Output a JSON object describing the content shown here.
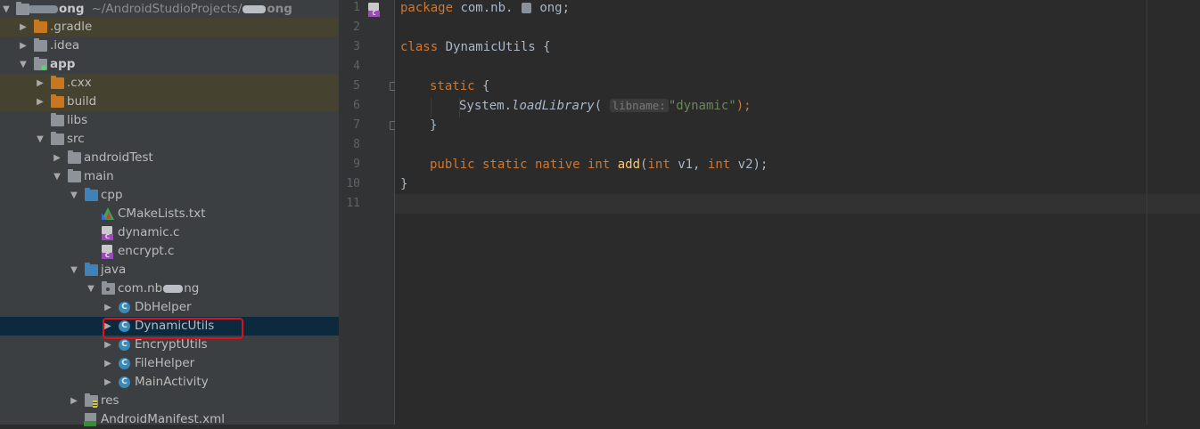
{
  "project": {
    "name_suffix": "ong",
    "path": "~/AndroidStudioProjects/",
    "path_suffix": "ong"
  },
  "tree": [
    {
      "label": ".gradle",
      "icon": "folder-orange",
      "arrow": "right",
      "excluded": true
    },
    {
      "label": ".idea",
      "icon": "folder-grey",
      "arrow": "right"
    },
    {
      "label": "app",
      "icon": "module",
      "arrow": "down",
      "bold": true
    },
    {
      "label": ".cxx",
      "icon": "folder-orange",
      "arrow": "right",
      "excluded": true
    },
    {
      "label": "build",
      "icon": "folder-orange",
      "arrow": "right",
      "excluded": true
    },
    {
      "label": "libs",
      "icon": "folder-grey",
      "arrow": "none"
    },
    {
      "label": "src",
      "icon": "folder-grey",
      "arrow": "down"
    },
    {
      "label": "androidTest",
      "icon": "folder-grey",
      "arrow": "right"
    },
    {
      "label": "main",
      "icon": "folder-grey",
      "arrow": "down"
    },
    {
      "label": "cpp",
      "icon": "folder-blue",
      "arrow": "down"
    },
    {
      "label": "CMakeLists.txt",
      "icon": "cmake-file",
      "arrow": "none"
    },
    {
      "label": "dynamic.c",
      "icon": "c-file",
      "arrow": "none"
    },
    {
      "label": "encrypt.c",
      "icon": "c-file",
      "arrow": "none"
    },
    {
      "label": "java",
      "icon": "folder-blue",
      "arrow": "down"
    },
    {
      "label": "com.nb",
      "label_suffix": "ng",
      "icon": "package",
      "arrow": "down"
    },
    {
      "label": "DbHelper",
      "icon": "class",
      "arrow": "right"
    },
    {
      "label": "DynamicUtils",
      "icon": "class",
      "arrow": "right",
      "selected": true
    },
    {
      "label": "EncryptUtils",
      "icon": "class",
      "arrow": "right"
    },
    {
      "label": "FileHelper",
      "icon": "class",
      "arrow": "right"
    },
    {
      "label": "MainActivity",
      "icon": "class",
      "arrow": "right"
    },
    {
      "label": "res",
      "icon": "folder-res",
      "arrow": "right"
    },
    {
      "label": "AndroidManifest.xml",
      "icon": "xml-file",
      "arrow": "none"
    }
  ],
  "editor": {
    "line_numbers": [
      "1",
      "2",
      "3",
      "4",
      "5",
      "6",
      "7",
      "8",
      "9",
      "10",
      "11"
    ],
    "code": {
      "l1_kw": "package",
      "l1_pkg": " com.nb.",
      "l1_tail": "ong;",
      "l3_kw": "class",
      "l3_rest": " DynamicUtils {",
      "l5_kw": "static",
      "l5_rest": " {",
      "l6_obj": "System.",
      "l6_method": "loadLibrary",
      "l6_open": "(",
      "l6_hint": "libname:",
      "l6_str": "\"dynamic\"",
      "l6_close": ");",
      "l7": "}",
      "l9_kw": "public static native int",
      "l9_fn": "add",
      "l9_p1_kw": "int",
      "l9_p1": " v1, ",
      "l9_p2_kw": "int",
      "l9_p2": " v2);",
      "l10": "}"
    }
  },
  "colors": {
    "keyword": "#cc7832",
    "function": "#ffc66d",
    "string": "#6a8759",
    "text": "#a9b7c6",
    "highlight_box": "#e0101a"
  }
}
